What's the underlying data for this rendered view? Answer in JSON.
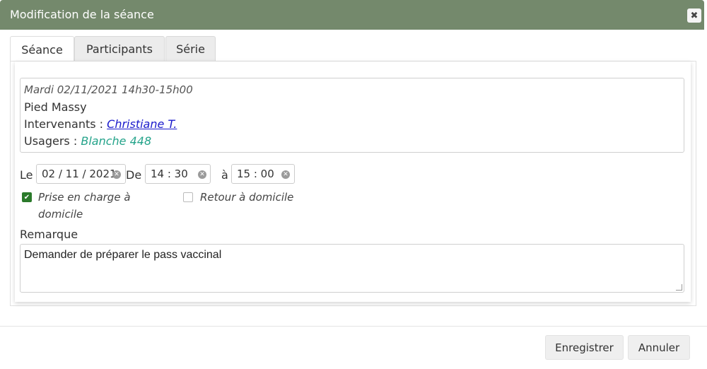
{
  "dialog": {
    "title": "Modification de la séance",
    "close_icon": "close-icon"
  },
  "tabs": [
    {
      "label": "Séance",
      "active": true
    },
    {
      "label": "Participants",
      "active": false
    },
    {
      "label": "Série",
      "active": false
    }
  ],
  "info": {
    "date": "Mardi 02/11/2021 14h30-15h00",
    "place": "Pied Massy",
    "intervenants_label": "Intervenants :",
    "intervenant": "Christiane T.",
    "usagers_label": "Usagers :",
    "usager": "Blanche 448"
  },
  "fields": {
    "le_label": "Le",
    "date_value": "02 / 11 / 2021",
    "de_label": "De",
    "start_value": "14 : 30",
    "a_label": "à",
    "end_value": "15 : 00"
  },
  "checkboxes": [
    {
      "line1": "Prise en charge à",
      "line2": "domicile",
      "checked": true
    },
    {
      "line1": "Retour à domicile",
      "checked": false
    }
  ],
  "remarque": {
    "label": "Remarque",
    "value": "Demander de préparer le pass vaccinal"
  },
  "buttons": {
    "save": "Enregistrer",
    "cancel": "Annuler"
  },
  "colors": {
    "titlebar": "#74896c",
    "checkbox": "#2b7a2b",
    "link": "#1a1acc",
    "usager": "#24a38a"
  }
}
